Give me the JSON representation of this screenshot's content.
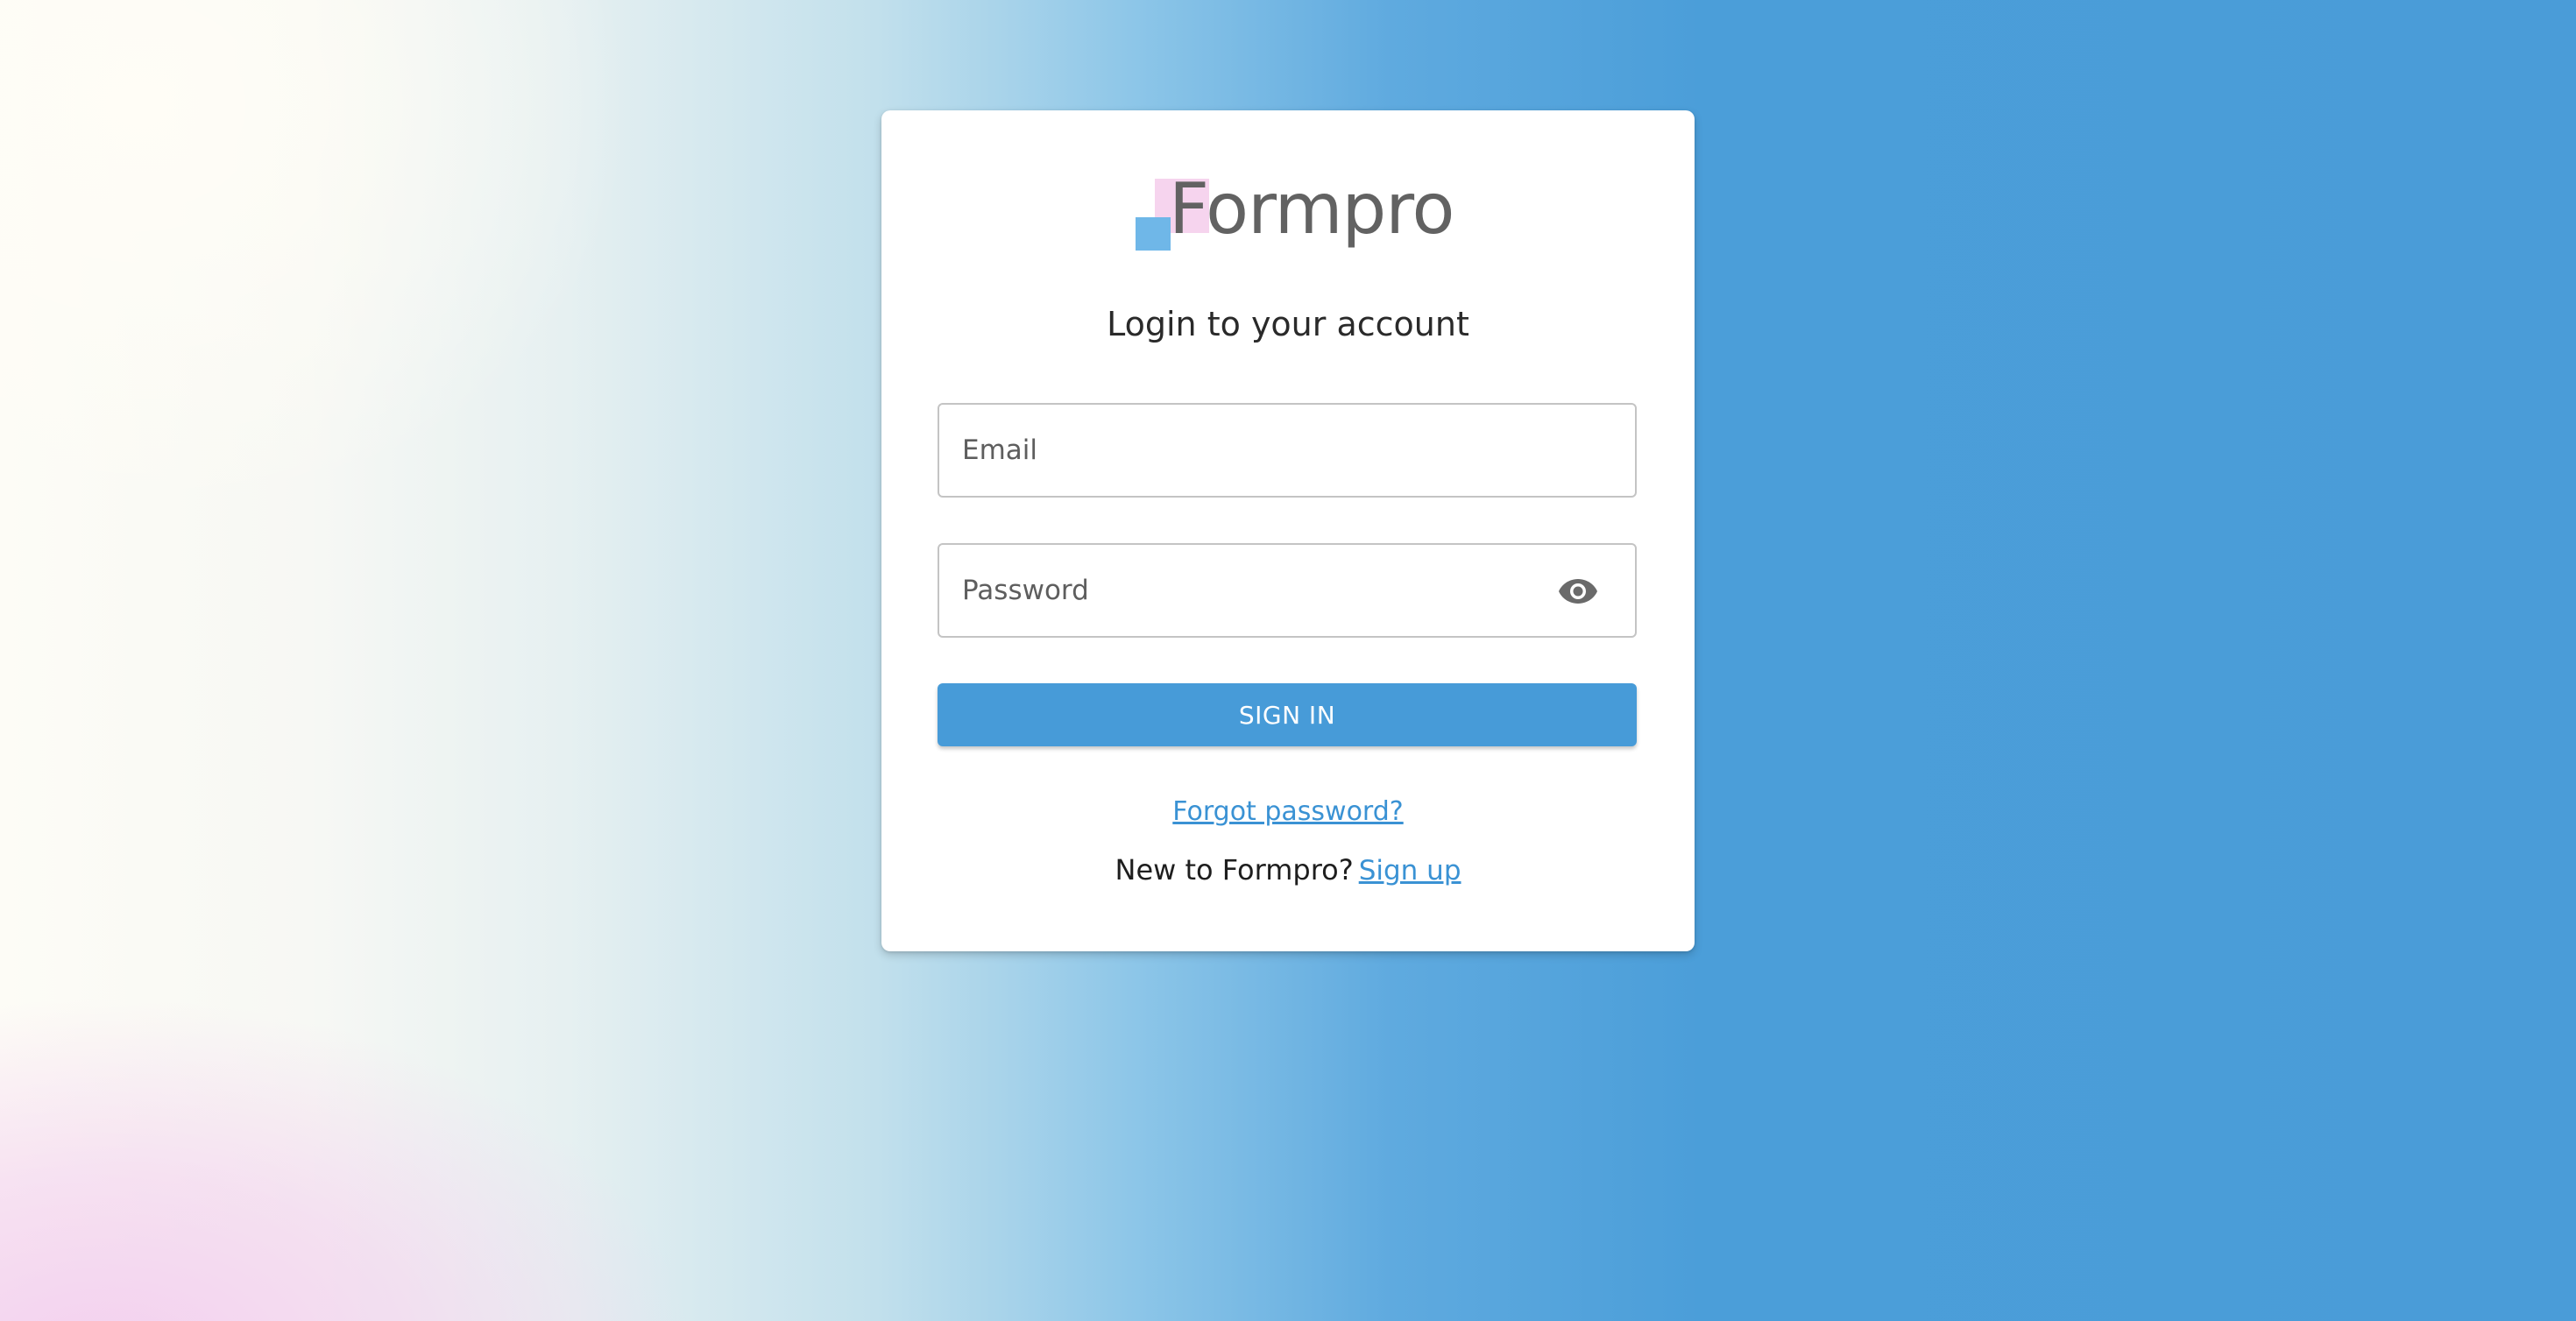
{
  "brand": {
    "name": "Formpro",
    "colors": {
      "logo_pink": "#f6d4ee",
      "logo_blue": "#6fb7e8",
      "accent": "#479bd8",
      "link": "#3a92d4"
    }
  },
  "login": {
    "heading": "Login to your account",
    "email": {
      "placeholder": "Email",
      "value": ""
    },
    "password": {
      "placeholder": "Password",
      "value": "",
      "toggle_icon": "eye-icon"
    },
    "sign_in_label": "SIGN IN",
    "forgot_label": "Forgot password?",
    "signup_prompt": "New to Formpro?",
    "signup_label": "Sign up"
  }
}
